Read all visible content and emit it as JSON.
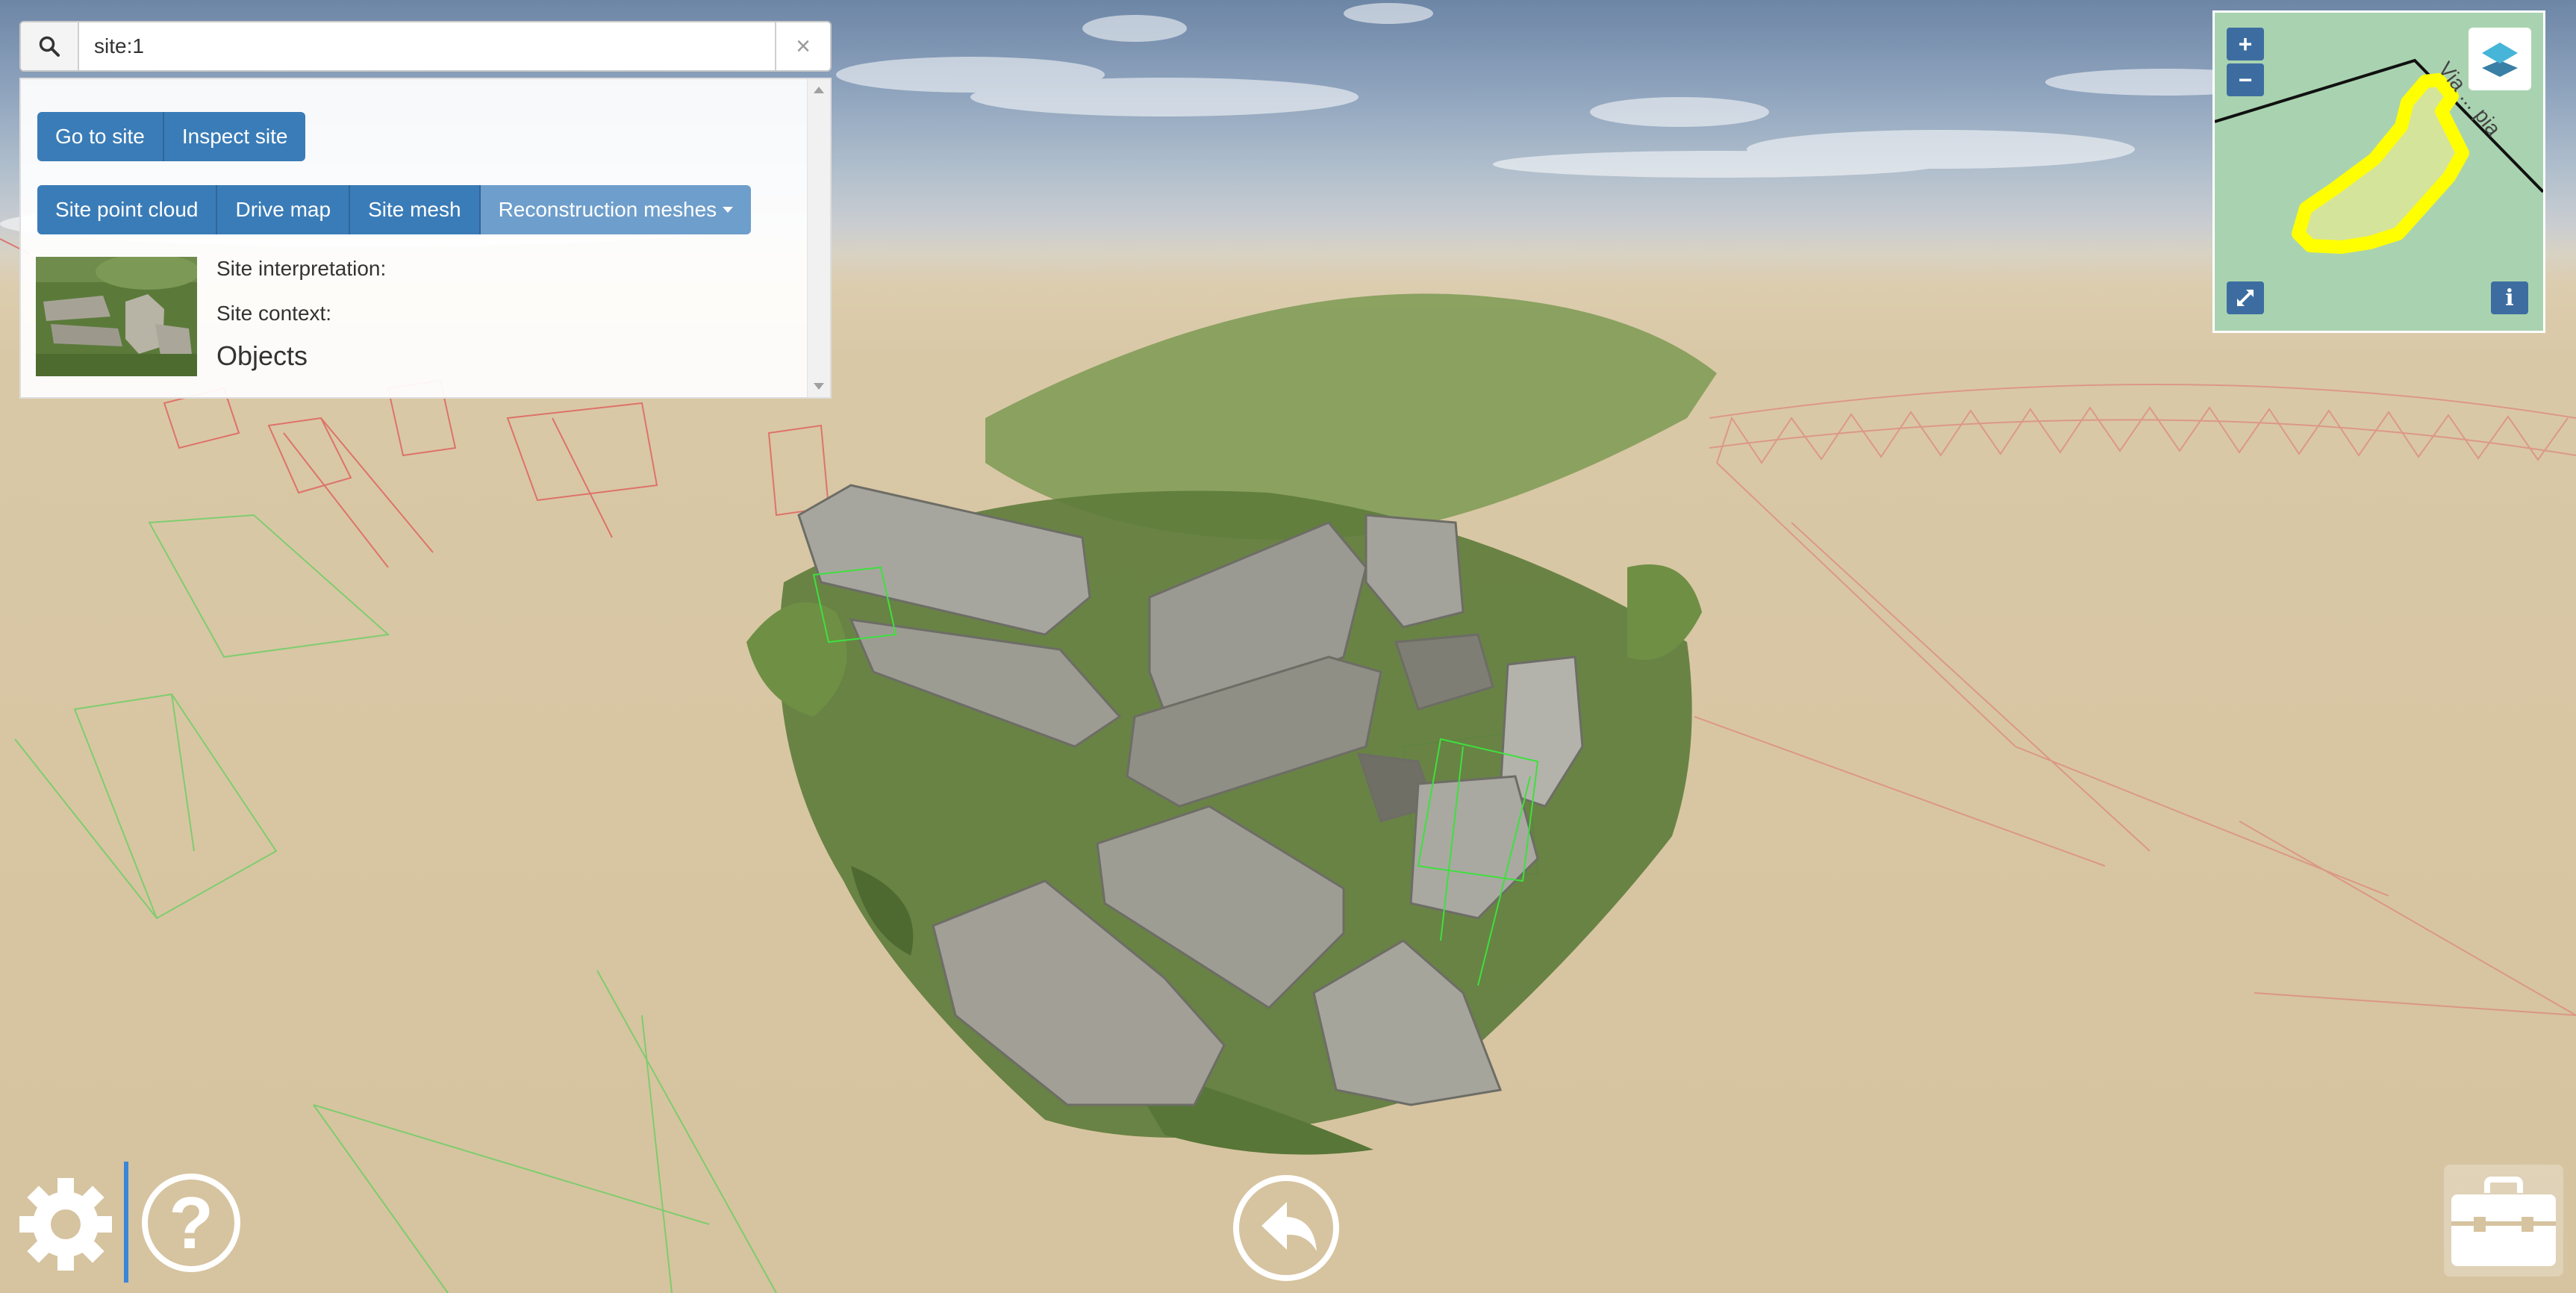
{
  "search": {
    "value": "site:1",
    "clear_label": "×"
  },
  "actions": {
    "go_to_site": "Go to site",
    "inspect_site": "Inspect site",
    "site_point_cloud": "Site point cloud",
    "drive_map": "Drive map",
    "site_mesh": "Site mesh",
    "reconstruction_meshes": "Reconstruction meshes"
  },
  "site_info": {
    "interpretation_label": "Site interpretation:",
    "context_label": "Site context:",
    "objects_heading": "Objects"
  },
  "minimap": {
    "zoom_in": "+",
    "zoom_out": "−",
    "info": "i",
    "road_label": "Via ... pia"
  },
  "help": {
    "symbol": "?"
  },
  "icons": {
    "search": "search-icon",
    "clear": "close-icon",
    "settings": "gear-icon",
    "help": "question-icon",
    "back": "undo-arrow-icon",
    "toolbox": "toolbox-icon",
    "layers": "layers-icon",
    "fullscreen": "expand-icon"
  },
  "colors": {
    "primary_button": "#3a7cb7",
    "dropdown_button": "#6e9ecb",
    "map_background": "#a9d3b0",
    "site_outline": "#ffff00",
    "divider": "#3a86d8"
  }
}
